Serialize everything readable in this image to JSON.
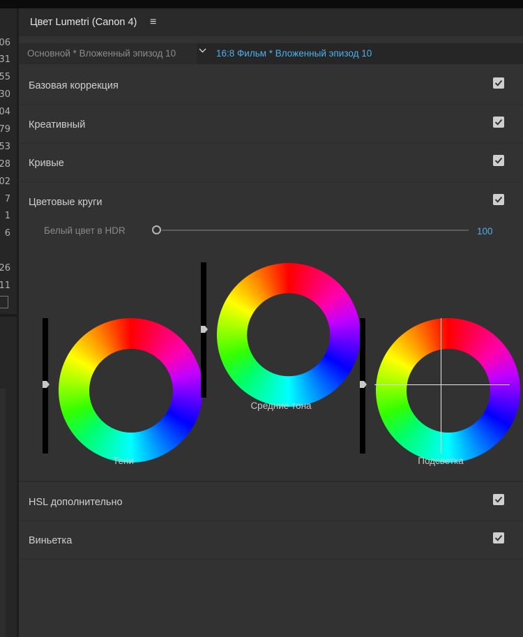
{
  "left_strip": {
    "numbers": [
      "06",
      "31",
      "55",
      "30",
      "04",
      "79",
      "53",
      "28",
      "02",
      "7",
      "1",
      "6",
      "26",
      "11"
    ]
  },
  "panel": {
    "title": "Цвет Lumetri (Canon 4)",
    "menu_icon": "hamburger-menu-icon",
    "clip_source": "Основной * Вложенный эпизод 10",
    "clip_target": "16:8 Фильм * Вложенный эпизод 10"
  },
  "sections": [
    {
      "label": "Базовая коррекция",
      "checked": true
    },
    {
      "label": "Креативный",
      "checked": true
    },
    {
      "label": "Кривые",
      "checked": true
    },
    {
      "label": "Цветовые круги",
      "checked": true
    },
    {
      "label": "HSL дополнительно",
      "checked": true
    },
    {
      "label": "Виньетка",
      "checked": true
    }
  ],
  "hdr": {
    "label": "Белый цвет в HDR",
    "value": "100",
    "slider_fraction": 0.0
  },
  "wheels": {
    "shadows": {
      "label": "Тени"
    },
    "midtones": {
      "label": "Средние тона"
    },
    "highlights": {
      "label": "Подсветка"
    }
  },
  "colors": {
    "accent_blue": "#4cb0ee",
    "panel_bg": "#323232"
  }
}
